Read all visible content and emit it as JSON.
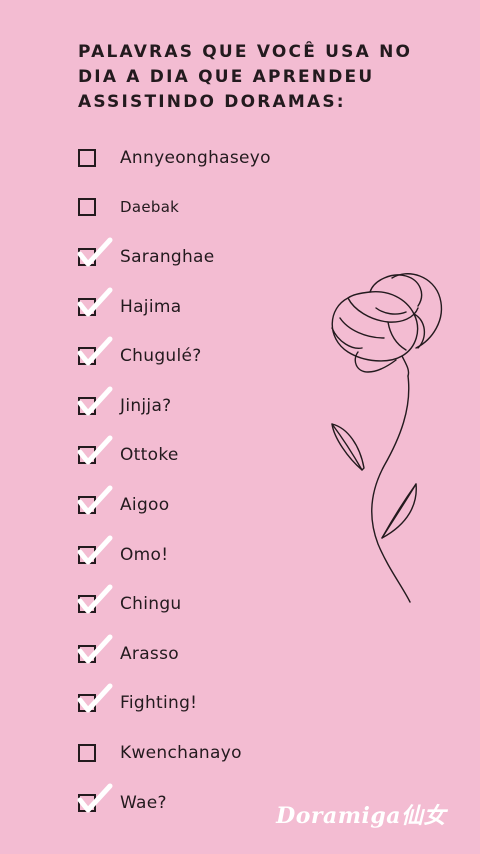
{
  "title": {
    "line1": "PALAVRAS QUE VOCÊ USA NO",
    "line2": "DIA A DIA QUE APRENDEU",
    "line3": "ASSISTINDO DORAMAS:"
  },
  "items": [
    {
      "label": "Annyeonghaseyo",
      "checked": false
    },
    {
      "label": "Daebak",
      "checked": false
    },
    {
      "label": "Saranghae",
      "checked": true
    },
    {
      "label": "Hajima",
      "checked": true
    },
    {
      "label": "Chugulé?",
      "checked": true
    },
    {
      "label": "Jinjja?",
      "checked": true
    },
    {
      "label": "Ottoke",
      "checked": true
    },
    {
      "label": "Aigoo",
      "checked": true
    },
    {
      "label": "Omo!",
      "checked": true
    },
    {
      "label": "Chingu",
      "checked": true
    },
    {
      "label": "Arasso",
      "checked": true
    },
    {
      "label": "Fighting!",
      "checked": true
    },
    {
      "label": "Kwenchanayo",
      "checked": false
    },
    {
      "label": "Wae?",
      "checked": true
    }
  ],
  "brand": "Doramiga仙女",
  "colors": {
    "background": "#f3bcd2",
    "ink": "#231a1e",
    "checkmark": "#ffffff"
  }
}
